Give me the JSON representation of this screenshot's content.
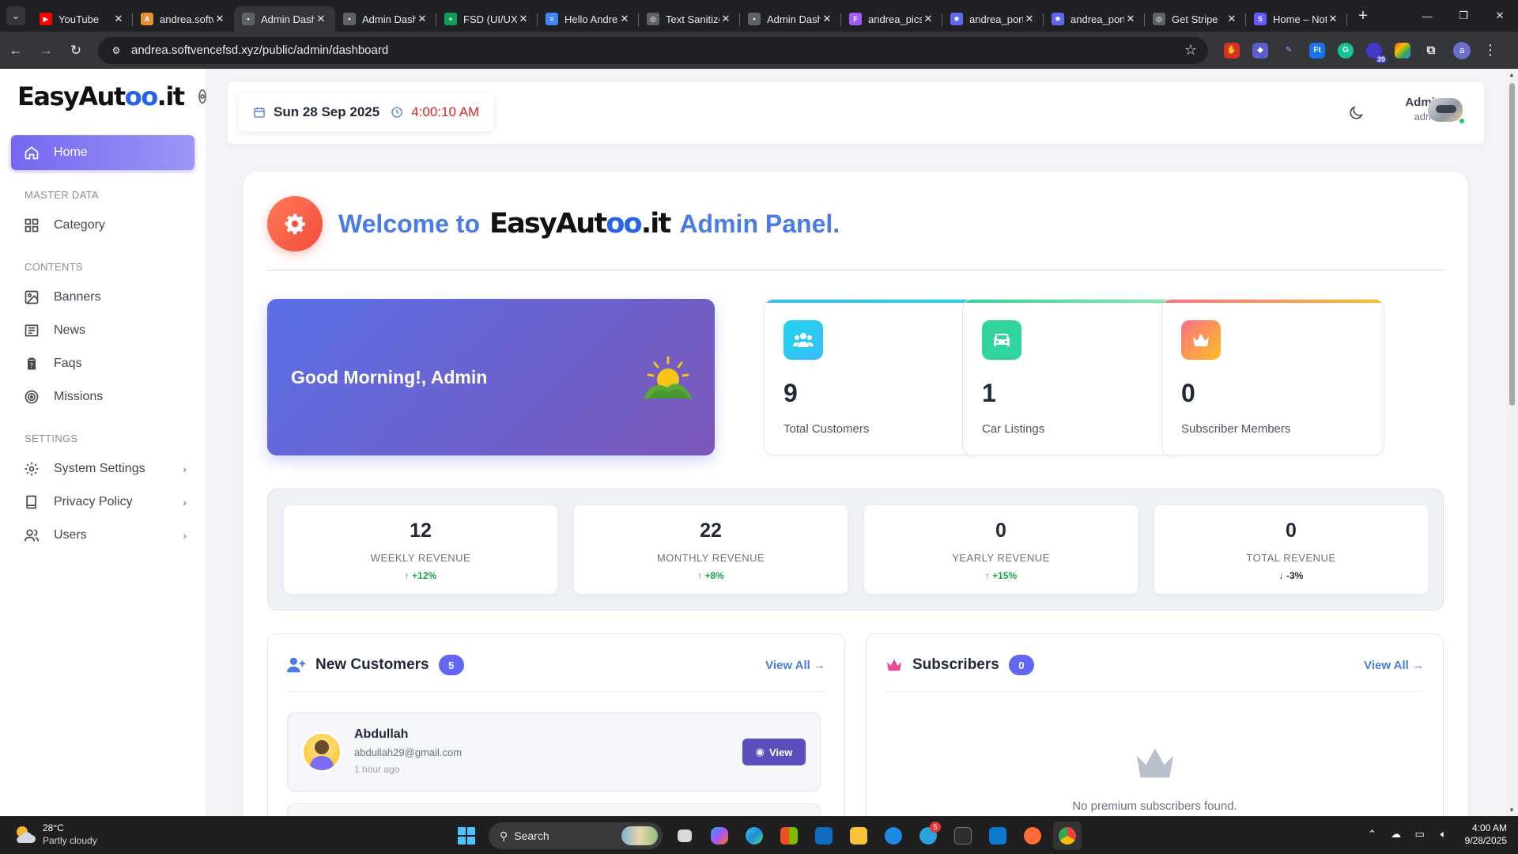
{
  "browser": {
    "tabs": [
      {
        "title": "YouTube",
        "color": "#ff0000",
        "glyph": "▶"
      },
      {
        "title": "andrea.softvencefsd",
        "color": "#e69138",
        "glyph": "A"
      },
      {
        "title": "Admin Dashboard",
        "color": "#5f6368",
        "glyph": "•"
      },
      {
        "title": "Admin Dashboard",
        "color": "#5f6368",
        "glyph": "•"
      },
      {
        "title": "FSD (UI/UX)",
        "color": "#0f9d58",
        "glyph": "+"
      },
      {
        "title": "Hello Andrea",
        "color": "#4285f4",
        "glyph": "≡"
      },
      {
        "title": "Text Sanitizer",
        "color": "#5f6368",
        "glyph": "◎"
      },
      {
        "title": "Admin Dashboard",
        "color": "#5f6368",
        "glyph": "•"
      },
      {
        "title": "andrea_pics",
        "color": "#a259ff",
        "glyph": "F"
      },
      {
        "title": "andrea_portal",
        "color": "#6366f1",
        "glyph": "✹"
      },
      {
        "title": "andrea_portal",
        "color": "#6366f1",
        "glyph": "✹"
      },
      {
        "title": "Get Stripe",
        "color": "#5f6368",
        "glyph": "◎"
      },
      {
        "title": "Home – Notion",
        "color": "#635bff",
        "glyph": "S"
      }
    ],
    "url": "andrea.softvencefsd.xyz/public/admin/dashboard",
    "extension_badge": "39",
    "profile_initial": "a"
  },
  "sidebar": {
    "logo_prefix": "EasyAut",
    "logo_accent": "oo",
    "logo_suffix": ".it",
    "home": "Home",
    "sections": {
      "master": "MASTER DATA",
      "contents": "CONTENTS",
      "settings": "SETTINGS"
    },
    "items": {
      "category": "Category",
      "banners": "Banners",
      "news": "News",
      "faqs": "Faqs",
      "missions": "Missions",
      "system_settings": "System Settings",
      "privacy_policy": "Privacy Policy",
      "users": "Users"
    }
  },
  "header": {
    "date": "Sun 28 Sep 2025",
    "time": "4:00:10 AM",
    "user_name": "Admin",
    "user_role": "admin"
  },
  "welcome": {
    "prefix": "Welcome to",
    "brand_prefix": "EasyAut",
    "brand_accent": "oo",
    "brand_suffix": ".it",
    "suffix": "Admin Panel."
  },
  "greeting": "Good Morning!, Admin",
  "stats": [
    {
      "value": "9",
      "label": "Total Customers",
      "icon": "users-icon",
      "bar": "#38bdf8",
      "icon_bg": "#22c3ee"
    },
    {
      "value": "1",
      "label": "Car Listings",
      "icon": "car-icon",
      "bar": "#34d399",
      "icon_bg": "#2dd4a3"
    },
    {
      "value": "0",
      "label": "Subscriber Members",
      "icon": "crown-icon",
      "bar": "#f59e7b",
      "icon_bg": "#fb7185"
    }
  ],
  "revenue": [
    {
      "value": "12",
      "label": "WEEKLY REVENUE",
      "change": "+12%",
      "direction": "up"
    },
    {
      "value": "22",
      "label": "MONTHLY REVENUE",
      "change": "+8%",
      "direction": "up"
    },
    {
      "value": "0",
      "label": "YEARLY REVENUE",
      "change": "+15%",
      "direction": "up"
    },
    {
      "value": "0",
      "label": "TOTAL REVENUE",
      "change": "-3%",
      "direction": "down"
    }
  ],
  "new_customers": {
    "title": "New Customers",
    "count": "5",
    "view_all": "View All",
    "items": [
      {
        "name": "Abdullah",
        "email": "abdullah29@gmail.com",
        "time": "1 hour ago",
        "action": "View"
      }
    ]
  },
  "subscribers": {
    "title": "Subscribers",
    "count": "0",
    "view_all": "View All",
    "empty": "No premium subscribers found."
  },
  "taskbar": {
    "temp": "28°C",
    "condition": "Partly cloudy",
    "search": "Search",
    "telegram_badge": "5",
    "time": "4:00 AM",
    "date": "9/28/2025"
  }
}
